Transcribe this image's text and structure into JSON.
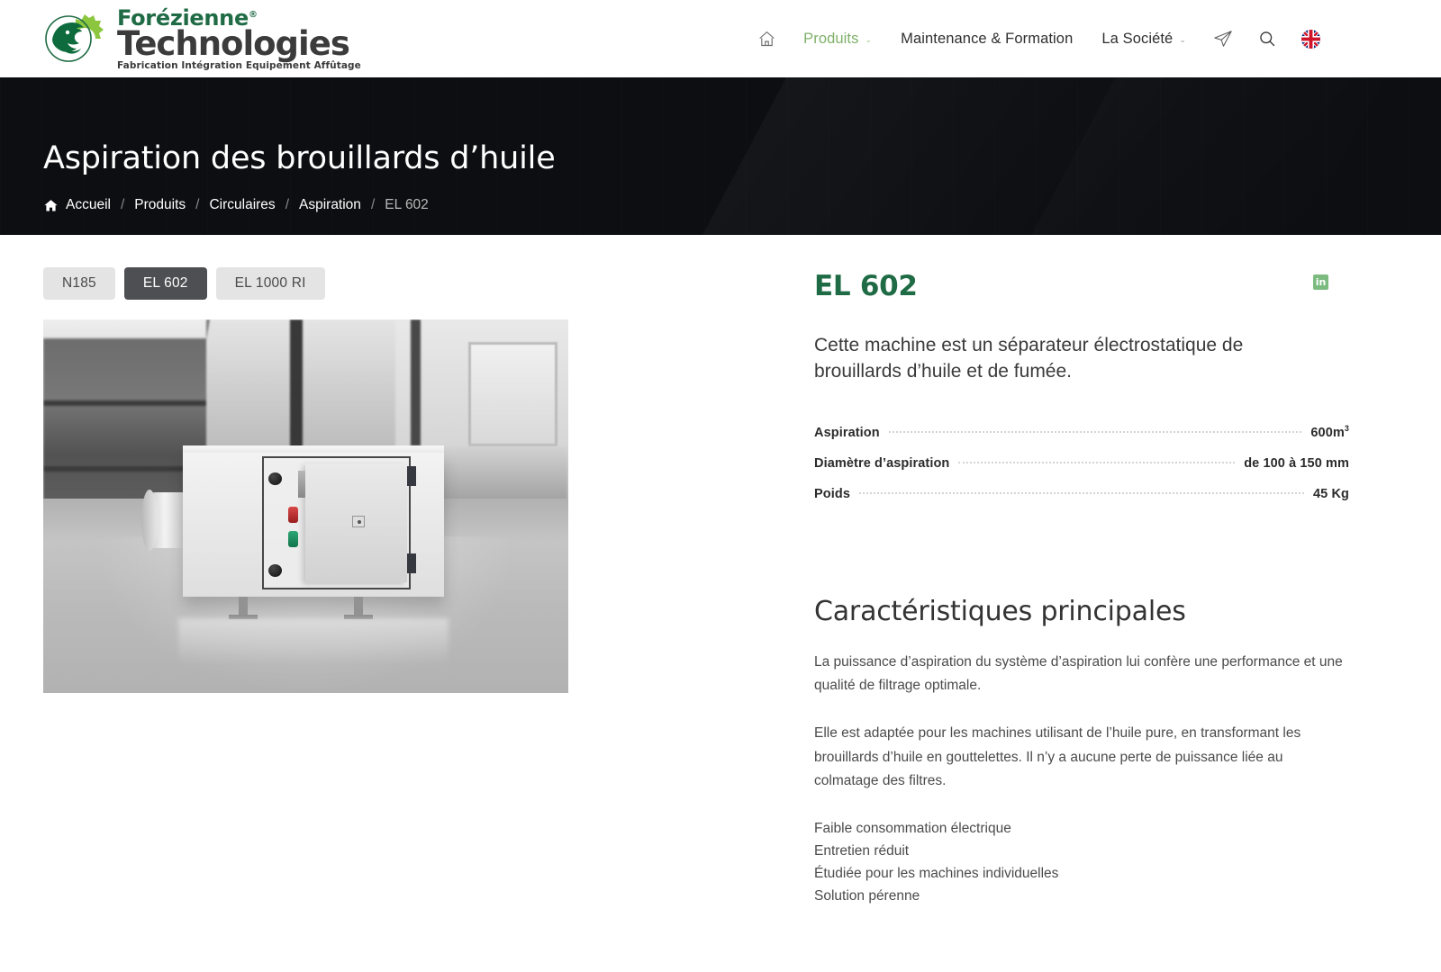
{
  "header": {
    "logo": {
      "line1": "Forézienne",
      "registered": "®",
      "line2": "Technologies",
      "tagline": "Fabrication Intégration Equipement Affûtage"
    },
    "nav": [
      {
        "label": "Produits",
        "active": true,
        "has_caret": true
      },
      {
        "label": "Maintenance & Formation",
        "active": false,
        "has_caret": false
      },
      {
        "label": "La Société",
        "active": false,
        "has_caret": true
      }
    ],
    "icons": {
      "home": "home-icon",
      "send": "paper-plane-icon",
      "search": "search-icon",
      "language_flag": "uk-flag-icon"
    },
    "caret_glyph": "⌄"
  },
  "hero": {
    "title": "Aspiration des brouillards d’huile",
    "breadcrumb": {
      "home_icon": "home-icon",
      "items": [
        "Accueil",
        "Produits",
        "Circulaires",
        "Aspiration"
      ],
      "current": "EL 602",
      "separator": "/"
    }
  },
  "tabs": [
    {
      "label": "N185",
      "active": false
    },
    {
      "label": "EL 602",
      "active": true
    },
    {
      "label": "EL 1000 RI",
      "active": false
    }
  ],
  "gallery": {
    "image_alt": "Photographie noir et blanc du séparateur électrostatique EL 602 dans un atelier"
  },
  "product": {
    "title": "EL 602",
    "share_icon": "linkedin-icon",
    "share_label": "in",
    "lede": "Cette machine est un séparateur électrostatique de brouillards d’huile et de fumée.",
    "specs": [
      {
        "label": "Aspiration",
        "value": "600m",
        "exponent": "3"
      },
      {
        "label": "Diamètre d’aspiration",
        "value": "de 100 à 150 mm",
        "exponent": ""
      },
      {
        "label": "Poids",
        "value": "45 Kg",
        "exponent": ""
      }
    ]
  },
  "features": {
    "title": "Caractéristiques principales",
    "paragraphs": [
      "La puissance d’aspiration du système d’aspiration lui confère une performance et une qualité de filtrage optimale.",
      "Elle est adaptée pour les machines utilisant de l’huile pure, en transformant les brouillards d’huile en gouttelettes. Il n’y a aucune perte de puissance liée au colmatage des filtres."
    ],
    "bullets": [
      "Faible consommation électrique",
      "Entretien réduit",
      "Étudiée pour les machines individuelles",
      "Solution pérenne"
    ]
  },
  "colors": {
    "brand_green": "#1f6b45",
    "accent_green": "#7fb069",
    "hero_bg": "#0c0e12",
    "tab_active_bg": "#4d4f52",
    "tab_bg": "#e4e4e4"
  }
}
